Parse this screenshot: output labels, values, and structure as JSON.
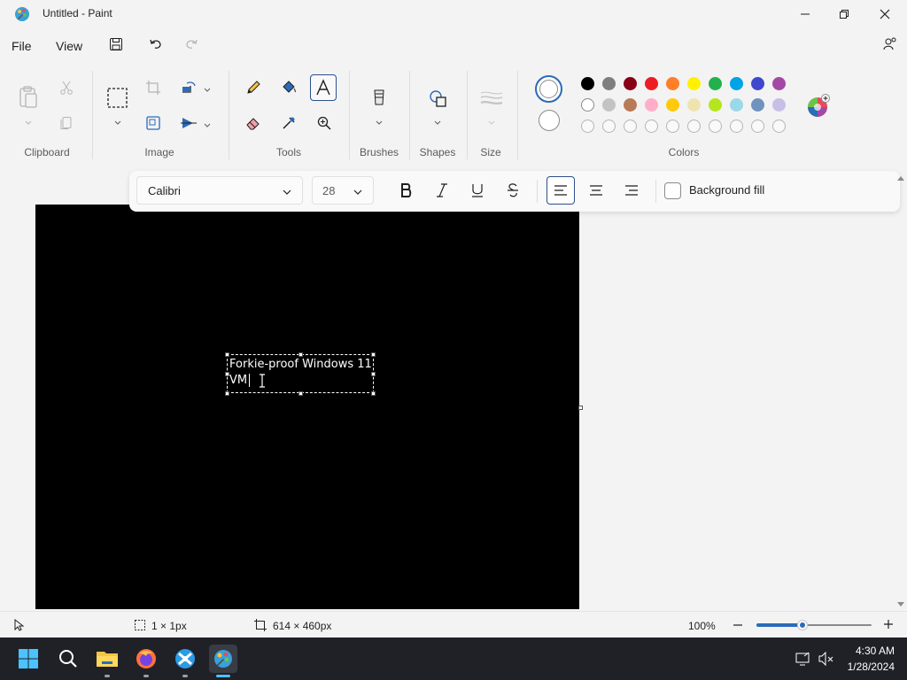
{
  "window": {
    "title": "Untitled - Paint"
  },
  "menu": {
    "file": "File",
    "view": "View"
  },
  "ribbon": {
    "groups": {
      "clipboard": "Clipboard",
      "image": "Image",
      "tools": "Tools",
      "brushes": "Brushes",
      "shapes": "Shapes",
      "size": "Size",
      "colors": "Colors"
    },
    "palette_row1": [
      "#000000",
      "#7f7f7f",
      "#880015",
      "#ed1c24",
      "#ff7f27",
      "#fff200",
      "#22b14c",
      "#00a2e8",
      "#3f48cc",
      "#a349a4"
    ],
    "palette_row2": [
      "#ffffff",
      "#c3c3c3",
      "#b97a57",
      "#ffaec9",
      "#ffc90e",
      "#efe4b0",
      "#b5e61d",
      "#99d9ea",
      "#7092be",
      "#c8bfe7"
    ]
  },
  "textbar": {
    "font": "Calibri",
    "size": "28",
    "background_fill": "Background fill"
  },
  "canvas": {
    "text_line1": "Forkie-proof Windows 11",
    "text_line2": "VM"
  },
  "status": {
    "selection_size": "1 × 1px",
    "canvas_size": "614 × 460px",
    "zoom": "100%",
    "zoom_level": 0.4
  },
  "clock": {
    "time": "4:30 AM",
    "date": "1/28/2024"
  }
}
